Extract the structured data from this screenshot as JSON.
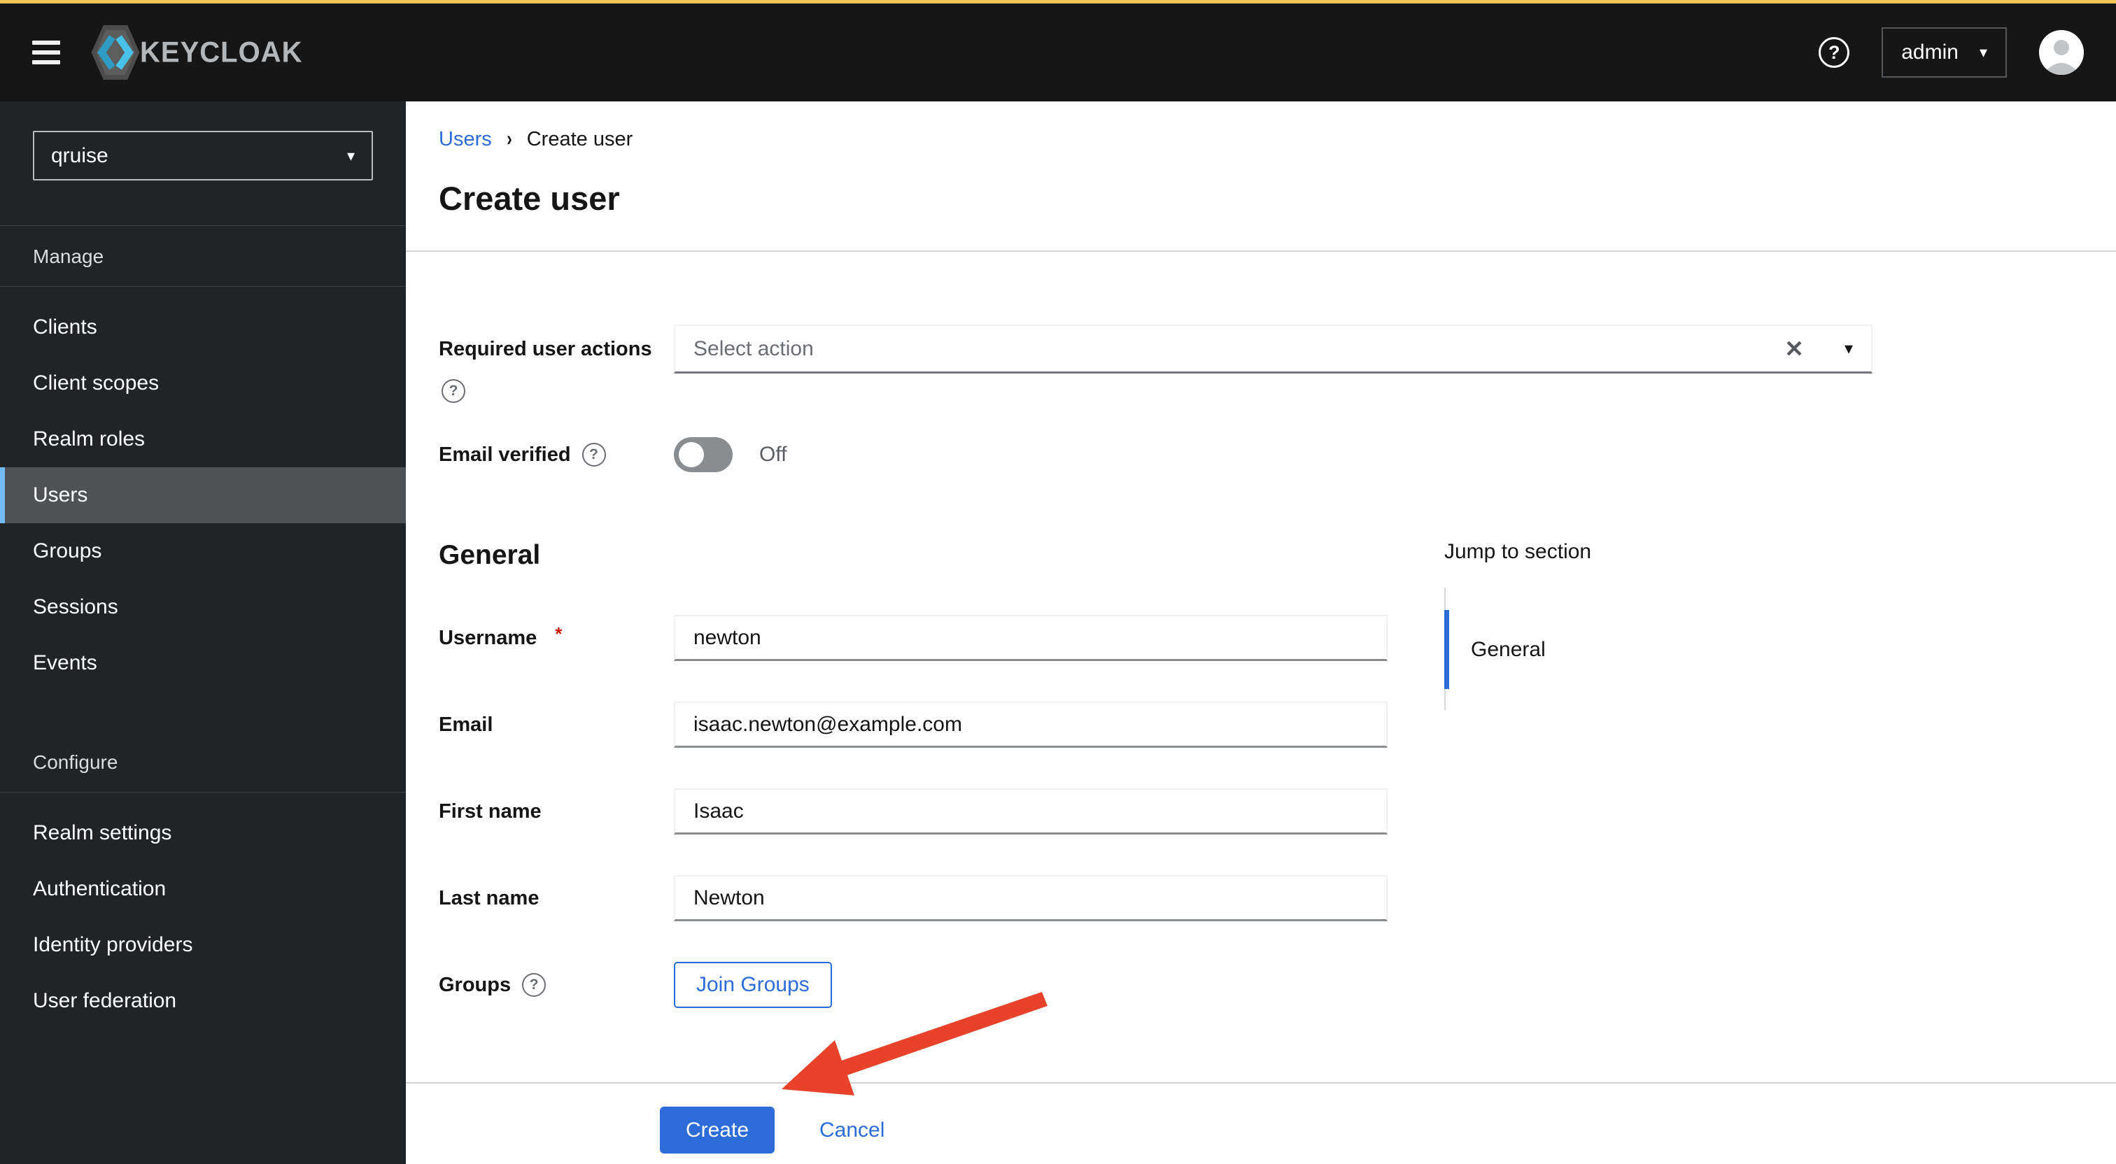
{
  "topbar": {
    "brand": "KEYCLOAK",
    "user_label": "admin"
  },
  "glyphs": {
    "caret": "▾",
    "clear": "✕",
    "breadcrumb_separator": "›",
    "question": "?"
  },
  "sidebar": {
    "realm_selector": {
      "value": "qruise"
    },
    "sections": [
      {
        "header": "Manage",
        "items": [
          {
            "label": "Clients"
          },
          {
            "label": "Client scopes"
          },
          {
            "label": "Realm roles"
          },
          {
            "label": "Users",
            "active": true
          },
          {
            "label": "Groups"
          },
          {
            "label": "Sessions"
          },
          {
            "label": "Events"
          }
        ]
      },
      {
        "header": "Configure",
        "items": [
          {
            "label": "Realm settings"
          },
          {
            "label": "Authentication"
          },
          {
            "label": "Identity providers"
          },
          {
            "label": "User federation"
          }
        ]
      }
    ]
  },
  "breadcrumb": {
    "items": [
      "Users",
      "Create user"
    ]
  },
  "page": {
    "title": "Create user"
  },
  "form": {
    "required_user_actions": {
      "label": "Required user actions",
      "placeholder": "Select action"
    },
    "email_verified": {
      "label": "Email verified",
      "state": "Off"
    },
    "general_heading": "General",
    "fields": [
      {
        "label": "Username",
        "required_marker": "*",
        "value": "newton"
      },
      {
        "label": "Email",
        "value": "isaac.newton@example.com"
      },
      {
        "label": "First name",
        "value": "Isaac"
      },
      {
        "label": "Last name",
        "value": "Newton"
      }
    ],
    "groups": {
      "label": "Groups",
      "button_label": "Join Groups"
    },
    "actions": {
      "create_label": "Create",
      "cancel_label": "Cancel"
    }
  },
  "jump_to_section": {
    "title": "Jump to section",
    "items": [
      {
        "label": "General",
        "active": true
      }
    ]
  },
  "colors": {
    "accent_blue": "#2b6cd8",
    "topbar_gold": "#f6c452",
    "arrow_red": "#e8432a",
    "sidebar_bg": "#212427",
    "sidebar_selected_bg": "#4f5255",
    "sidebar_selected_border": "#73bcf7",
    "danger_red": "#c9190b"
  }
}
